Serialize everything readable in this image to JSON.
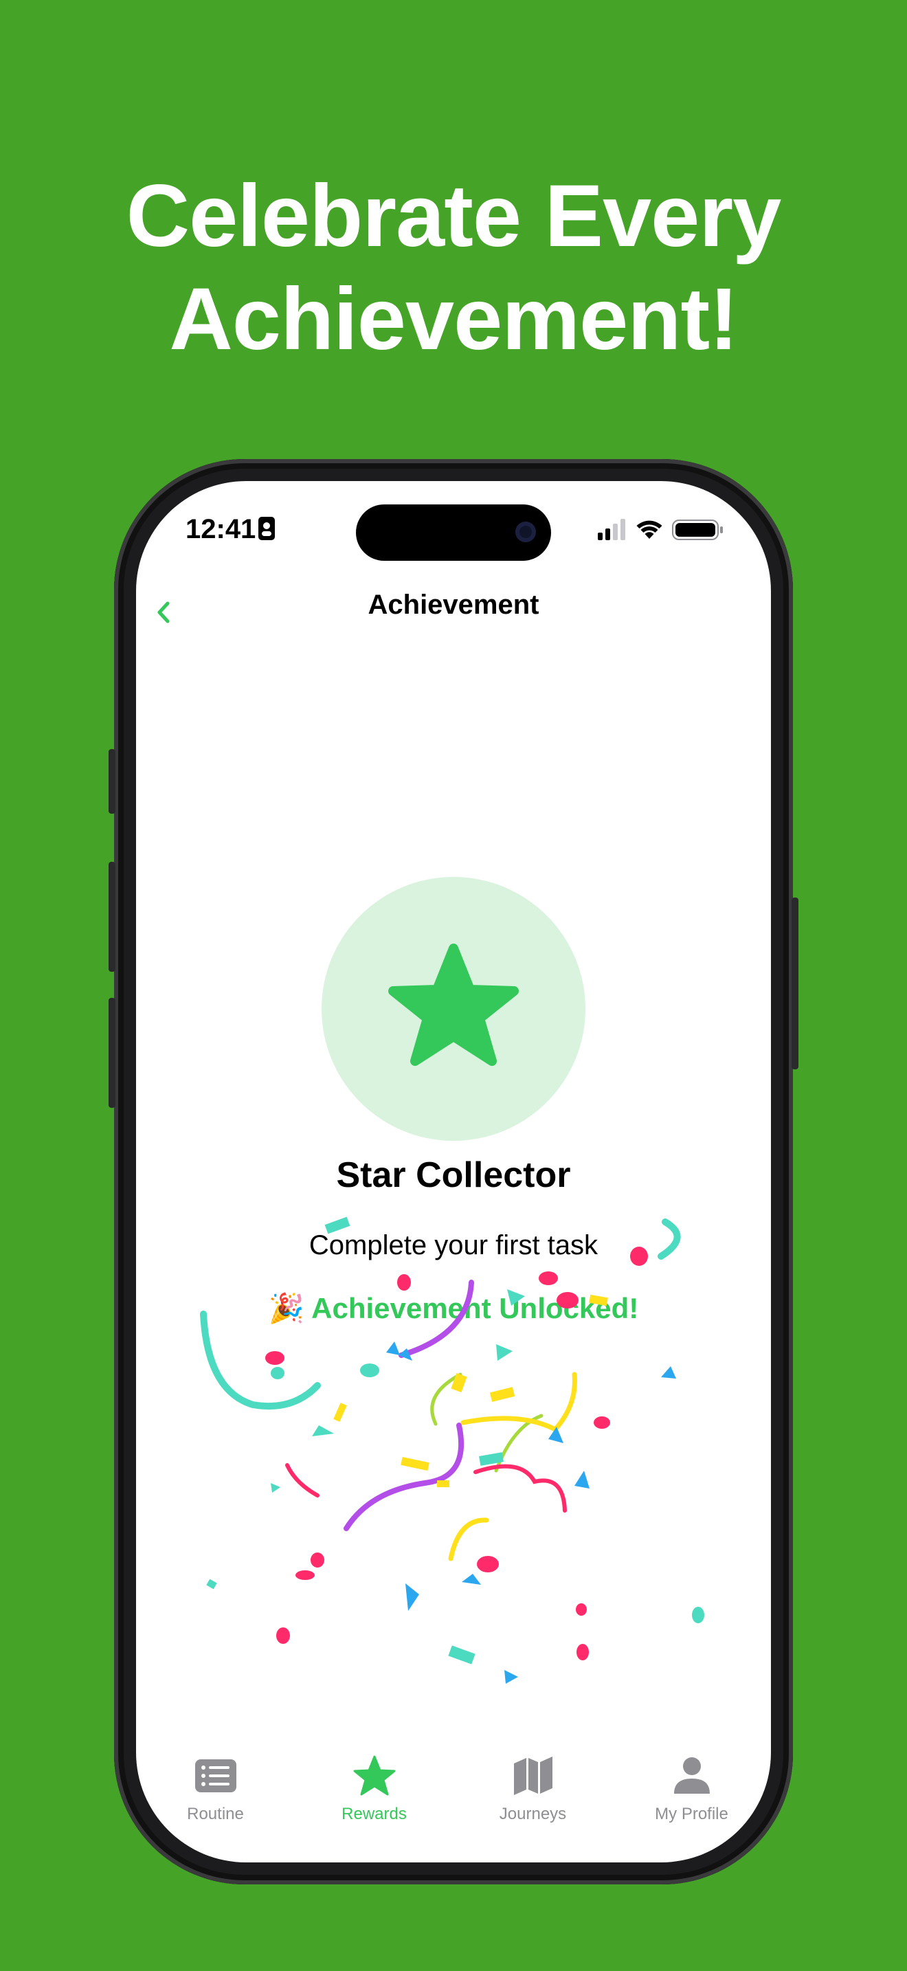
{
  "headline": {
    "line1": "Celebrate Every",
    "line2": "Achievement!"
  },
  "status_bar": {
    "time": "12:41"
  },
  "nav": {
    "title": "Achievement"
  },
  "achievement": {
    "title": "Star Collector",
    "description": "Complete your first task",
    "unlocked": "🎉 Achievement Unlocked!"
  },
  "tabs": [
    {
      "label": "Routine",
      "icon": "list-icon",
      "active": false
    },
    {
      "label": "Rewards",
      "icon": "star-icon",
      "active": true
    },
    {
      "label": "Journeys",
      "icon": "map-icon",
      "active": false
    },
    {
      "label": "My Profile",
      "icon": "person-icon",
      "active": false
    }
  ],
  "colors": {
    "background": "#45a427",
    "accent": "#34c759",
    "badge_circle": "#d9f3df",
    "tab_inactive": "#8e8e93"
  }
}
